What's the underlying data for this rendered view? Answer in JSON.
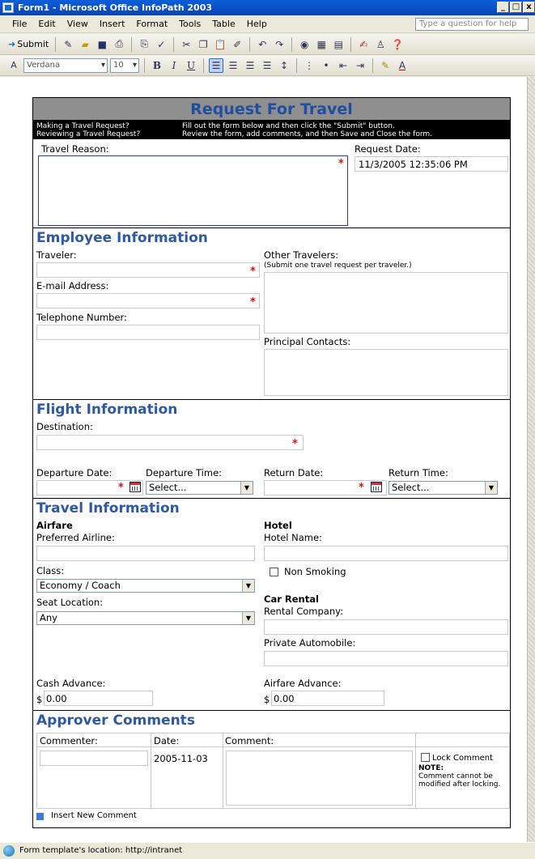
{
  "window": {
    "title": "Form1 - Microsoft Office InfoPath 2003",
    "min": "_",
    "max": "□",
    "close": "x"
  },
  "menu": {
    "items": [
      "File",
      "Edit",
      "View",
      "Insert",
      "Format",
      "Tools",
      "Table",
      "Help"
    ],
    "help_placeholder": "Type a question for help"
  },
  "toolbar": {
    "submit": "Submit",
    "font": "Verdana",
    "size": "10",
    "bold": "B",
    "italic": "I",
    "underline": "U",
    "font_color": "A"
  },
  "form": {
    "title": "Request For Travel",
    "inst": {
      "a1": "Making a Travel Request?",
      "a2": "Reviewing a Travel Request?",
      "b1": "Fill out the form below and then click the \"Submit\" button.",
      "b2": "Review the form, add comments, and then Save and Close the form."
    },
    "travel_reason": "Travel Reason:",
    "request_date_label": "Request Date:",
    "request_date_value": "11/3/2005 12:35:06 PM",
    "employee": {
      "heading": "Employee Information",
      "traveler": "Traveler:",
      "email": "E-mail Address:",
      "phone": "Telephone Number:",
      "other": "Other Travelers:",
      "other_note": "(Submit one travel request per traveler.)",
      "principal": "Principal Contacts:"
    },
    "flight": {
      "heading": "Flight Information",
      "destination": "Destination:",
      "dep_date": "Departure Date:",
      "dep_time": "Departure Time:",
      "ret_date": "Return Date:",
      "ret_time": "Return Time:",
      "select": "Select..."
    },
    "travel": {
      "heading": "Travel Information",
      "airfare": "Airfare",
      "airline": "Preferred Airline:",
      "class_label": "Class:",
      "class_value": "Economy / Coach",
      "seat_label": "Seat Location:",
      "seat_value": "Any",
      "hotel": "Hotel",
      "hotel_name": "Hotel Name:",
      "non_smoking": "Non Smoking",
      "car": "Car Rental",
      "rental": "Rental Company:",
      "private": "Private Automobile:",
      "cash": "Cash Advance:",
      "cash_value": "0.00",
      "air_adv": "Airfare Advance:",
      "air_adv_value": "0.00",
      "currency": "$"
    },
    "approver": {
      "heading": "Approver Comments",
      "commenter": "Commenter:",
      "date": "Date:",
      "comment": "Comment:",
      "date_value": "2005-11-03",
      "lock": "Lock Comment",
      "note": "NOTE:",
      "note_text": "Comment cannot be modified after locking.",
      "insert": "Insert New Comment"
    }
  },
  "status": "Form template's location: http://intranet"
}
